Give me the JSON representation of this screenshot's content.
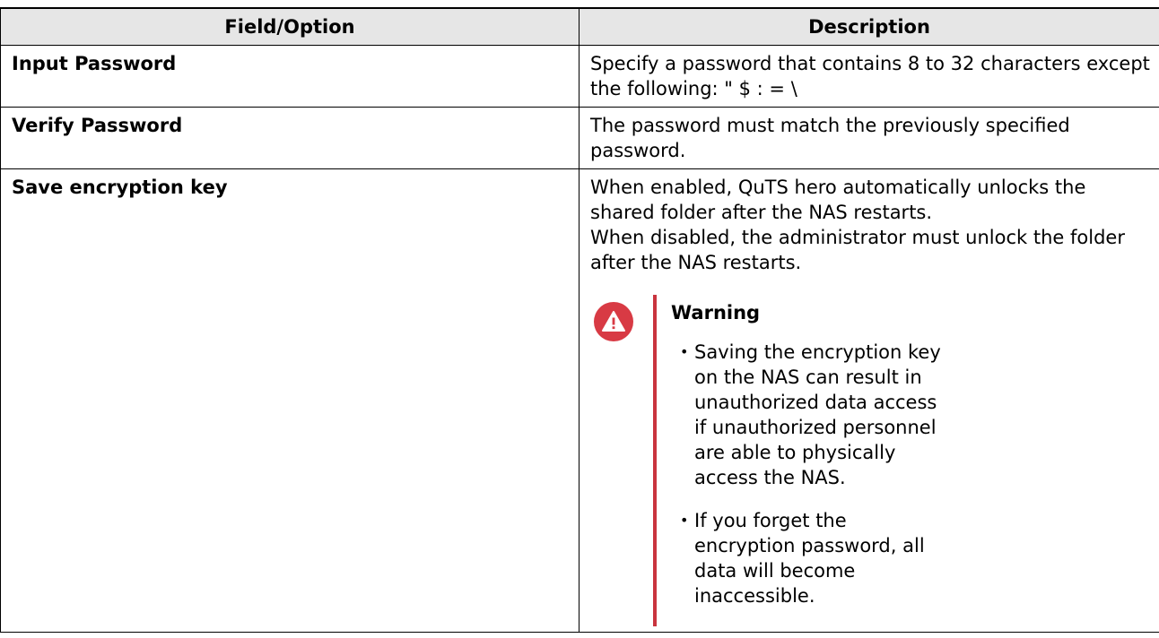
{
  "table": {
    "headers": {
      "field": "Field/Option",
      "description": "Description"
    },
    "rows": [
      {
        "field": "Input Password",
        "description": "Specify a password that contains 8 to 32 characters except the following: \" $ : = \\"
      },
      {
        "field": "Verify Password",
        "description": "The password must match the previously specified password."
      },
      {
        "field": "Save encryption key",
        "description_lines": [
          "When enabled, QuTS hero automatically unlocks the shared folder after the NAS restarts.",
          "When disabled, the administrator must unlock the folder after the NAS restarts."
        ],
        "warning": {
          "icon": "warning-triangle-icon",
          "title": "Warning",
          "items": [
            "Saving the encryption key on the NAS can result in unauthorized data access if unauthorized personnel are able to physically access the NAS.",
            "If you forget the encryption password, all data will become inaccessible."
          ]
        }
      }
    ]
  },
  "colors": {
    "header_bg": "#e6e6e6",
    "warning_red": "#d83a44"
  }
}
